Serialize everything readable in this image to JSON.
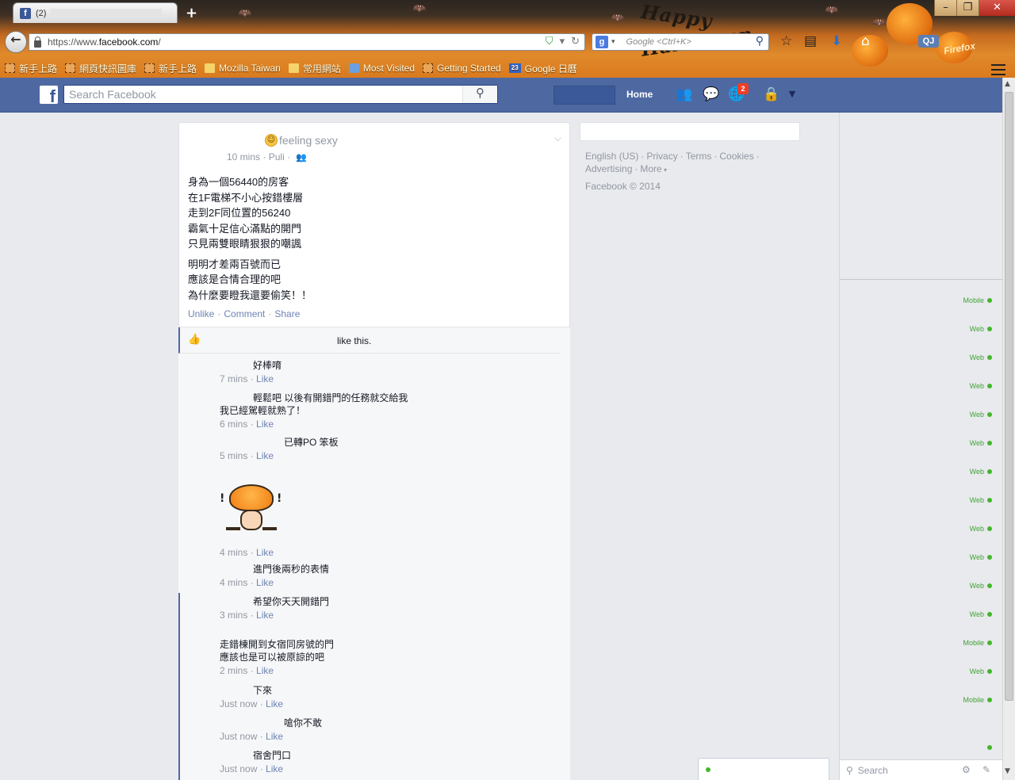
{
  "browser": {
    "tab_title": "(2)",
    "url_prefix": "https://www.",
    "url_domain": "facebook.com",
    "url_suffix": "/",
    "search_engine_letter": "g",
    "search_placeholder": "Google <Ctrl+K>",
    "theme_text_top": "Happy",
    "theme_text_bottom": "Halloween",
    "theme_brand": "Firefox",
    "extension_badge": "QJ",
    "bookmarks": [
      {
        "label": "新手上路",
        "icon": "dashed"
      },
      {
        "label": "網頁快訊圖庫",
        "icon": "dashed"
      },
      {
        "label": "新手上路",
        "icon": "dashed"
      },
      {
        "label": "Mozilla Taiwan",
        "icon": "folder"
      },
      {
        "label": "常用網站",
        "icon": "folder"
      },
      {
        "label": "Most Visited",
        "icon": "most-visited"
      },
      {
        "label": "Getting Started",
        "icon": "dashed"
      },
      {
        "label": "Google 日曆",
        "icon": "calendar",
        "badge": "23"
      }
    ]
  },
  "facebook": {
    "logo": "f",
    "search_placeholder": "Search Facebook",
    "home_label": "Home",
    "notifications_count": "2"
  },
  "post": {
    "feeling": "feeling sexy",
    "timestamp": "10 mins",
    "location": "Puli",
    "paragraph1": [
      "身為一個56440的房客",
      "在1F電梯不小心按錯樓層",
      "走到2F同位置的56240",
      "霸氣十足信心滿點的開門",
      "只見兩雙眼睛狠狠的嘲諷"
    ],
    "paragraph2": [
      "明明才差兩百號而已",
      "應該是合情合理的吧",
      "為什麼要瞪我還要偷笑！！"
    ],
    "actions": {
      "unlike": "Unlike",
      "comment": "Comment",
      "share": "Share"
    },
    "like_summary": "like this."
  },
  "comments": [
    {
      "text": "好棒唷",
      "indent": 42,
      "time": "7 mins",
      "like": "Like"
    },
    {
      "text": "輕鬆吧 以後有開錯門的任務就交給我",
      "text2": "我已經駕輕就熟了！",
      "indent": 42,
      "time": "6 mins",
      "like": "Like"
    },
    {
      "text": "已轉PO 笨板",
      "indent": 81,
      "time": "5 mins",
      "like": "Like"
    },
    {
      "sticker": true,
      "time": "4 mins",
      "like": "Like"
    },
    {
      "text": "進門後兩秒的表情",
      "indent": 42,
      "time": "4 mins",
      "like": "Like"
    },
    {
      "text": "希望你天天開錯門",
      "indent": 42,
      "time": "3 mins",
      "like": "Like"
    },
    {
      "text": "走錯棟開到女宿同房號的門",
      "text2": "應該也是可以被原諒的吧",
      "indent": 0,
      "time": "2 mins",
      "like": "Like"
    },
    {
      "text": "下來",
      "indent": 42,
      "time": "Just now",
      "like": "Like"
    },
    {
      "text": "嗆你不敢",
      "indent": 81,
      "time": "Just now",
      "like": "Like"
    },
    {
      "text": "宿舍門口",
      "indent": 42,
      "time": "Just now",
      "like": "Like"
    }
  ],
  "footer": {
    "links": [
      "English (US)",
      "Privacy",
      "Terms",
      "Cookies",
      "Advertising",
      "More"
    ],
    "copyright": "Facebook © 2014"
  },
  "chat": {
    "presence": [
      "Mobile",
      "Web",
      "Web",
      "Web",
      "Web",
      "Web",
      "Web",
      "Web",
      "Web",
      "Web",
      "Web",
      "Web",
      "Mobile",
      "Web",
      "Mobile"
    ],
    "search_label": "Search"
  }
}
